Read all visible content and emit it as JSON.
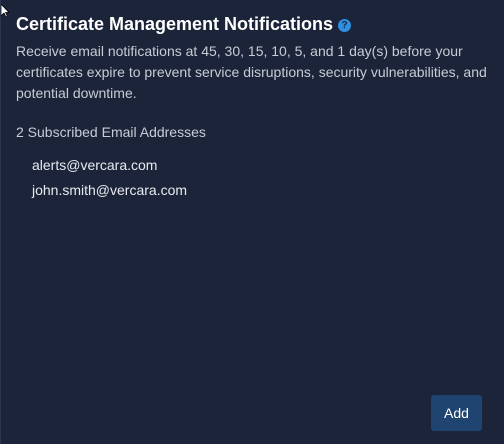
{
  "panel": {
    "title": "Certificate Management Notifications",
    "help_icon": "question-circle-icon",
    "description": "Receive email notifications at 45, 30, 15, 10, 5, and 1 day(s) before your certificates expire to prevent service disruptions, security vulnerabilities, and potential downtime.",
    "subscribed_heading": "2 Subscribed Email Addresses",
    "emails": [
      "alerts@vercara.com",
      "john.smith@vercara.com"
    ],
    "add_label": "Add"
  },
  "colors": {
    "background": "#1b2438",
    "accent": "#2f8fe3",
    "button": "#1f4470"
  }
}
